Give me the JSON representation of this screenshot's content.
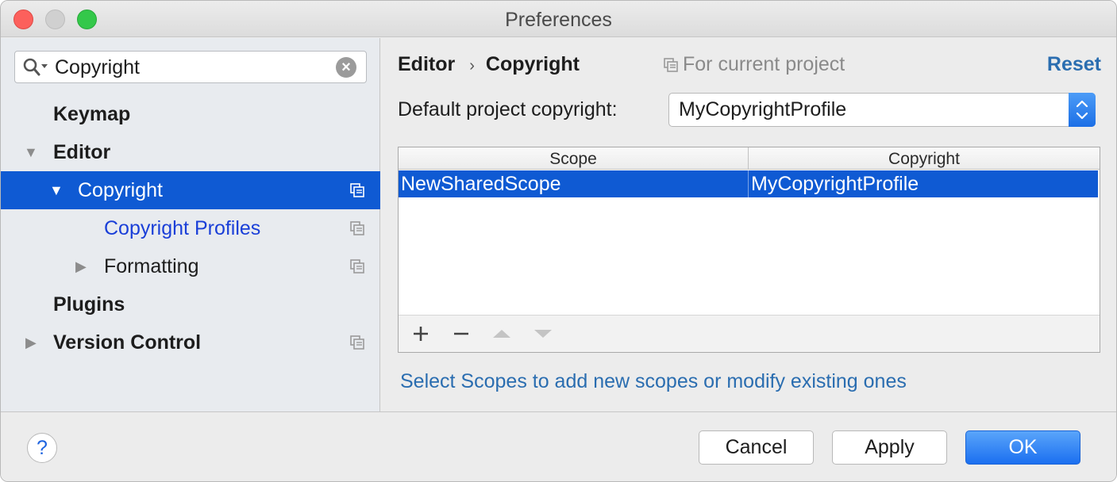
{
  "window": {
    "title": "Preferences"
  },
  "sidebar": {
    "search": {
      "value": "Copyright"
    },
    "items": [
      {
        "label": "Keymap",
        "level": 0,
        "bold": true,
        "expandable": false,
        "selected": false,
        "has_project_icon": false
      },
      {
        "label": "Editor",
        "level": 0,
        "bold": true,
        "expandable": true,
        "expanded": true,
        "selected": false,
        "has_project_icon": false
      },
      {
        "label": "Copyright",
        "level": 1,
        "bold": false,
        "expandable": true,
        "expanded": true,
        "selected": true,
        "has_project_icon": true
      },
      {
        "label": "Copyright Profiles",
        "level": 2,
        "bold": false,
        "expandable": false,
        "selected": false,
        "link": true,
        "has_project_icon": true
      },
      {
        "label": "Formatting",
        "level": 2,
        "bold": false,
        "expandable": true,
        "expanded": false,
        "selected": false,
        "has_project_icon": true
      },
      {
        "label": "Plugins",
        "level": 0,
        "bold": true,
        "expandable": false,
        "selected": false,
        "has_project_icon": false
      },
      {
        "label": "Version Control",
        "level": 0,
        "bold": true,
        "expandable": true,
        "expanded": false,
        "selected": false,
        "has_project_icon": true
      }
    ]
  },
  "content": {
    "breadcrumb": [
      "Editor",
      "Copyright"
    ],
    "scope_note": "For current project",
    "reset_label": "Reset",
    "default_copyright": {
      "label": "Default project copyright:",
      "value": "MyCopyrightProfile"
    },
    "table": {
      "columns": [
        "Scope",
        "Copyright"
      ],
      "rows": [
        {
          "scope": "NewSharedScope",
          "copyright": "MyCopyrightProfile",
          "selected": true
        }
      ],
      "toolbar": [
        "add-icon",
        "remove-icon",
        "move-up-icon",
        "move-down-icon"
      ]
    },
    "hint": "Select Scopes to add new scopes or modify existing ones"
  },
  "footer": {
    "help_label": "?",
    "cancel_label": "Cancel",
    "apply_label": "Apply",
    "ok_label": "OK"
  },
  "colors": {
    "selection": "#0f5ad3",
    "link": "#2a6db0",
    "accent": "#1b6ff0"
  }
}
